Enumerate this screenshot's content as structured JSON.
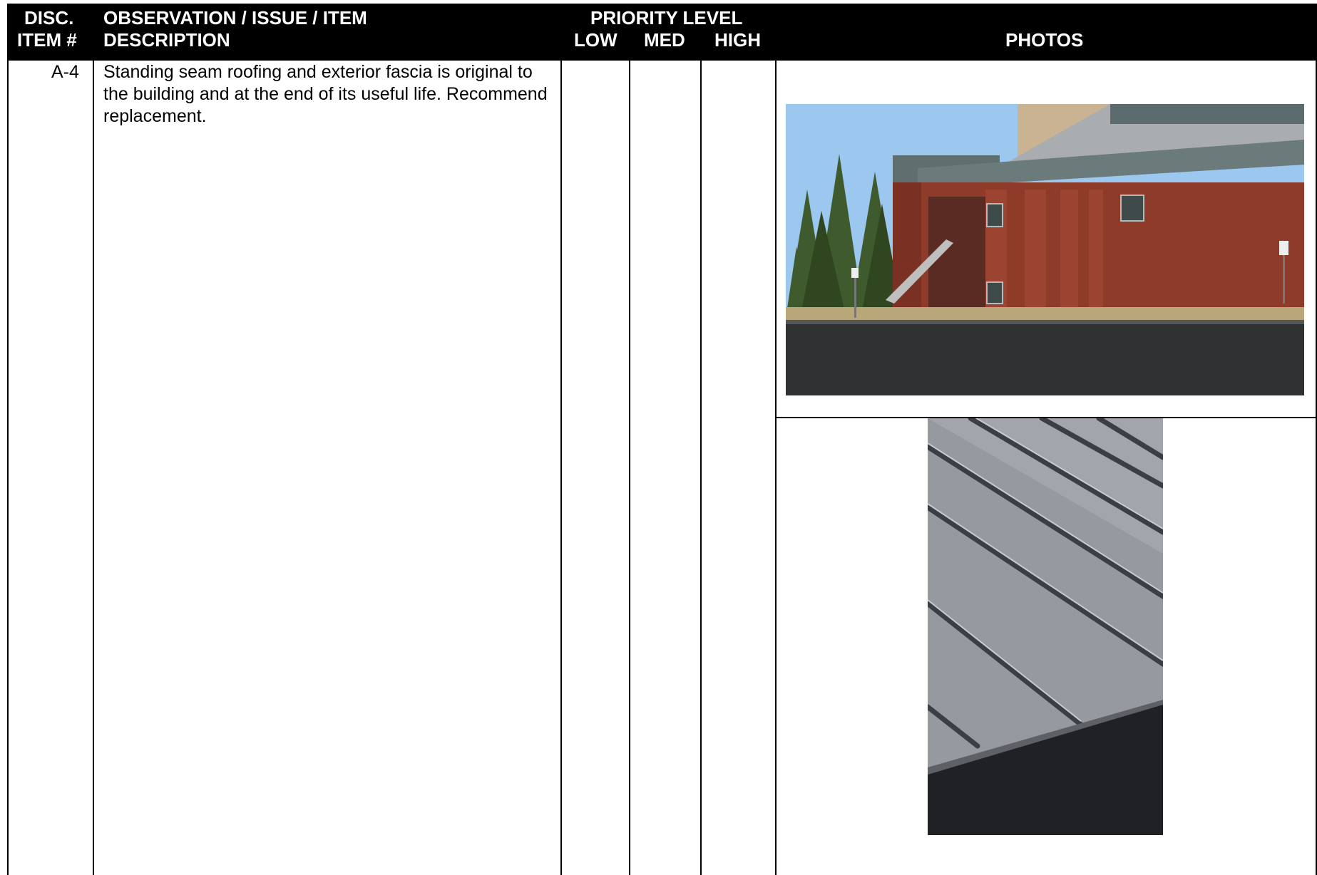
{
  "header": {
    "disc_line1": "DISC.",
    "disc_line2": "ITEM #",
    "obs_line1": "OBSERVATION / ISSUE / ITEM",
    "obs_line2": "DESCRIPTION",
    "priority": "PRIORITY LEVEL",
    "low": "LOW",
    "med": "MED",
    "high": "HIGH",
    "photos": "PHOTOS"
  },
  "rows": [
    {
      "item": "A-4",
      "description": "Standing seam roofing and exterior fascia is original to the building and at the end of its useful life. Recommend replacement.",
      "priority": {
        "low": "",
        "med": "",
        "high": ""
      }
    }
  ],
  "colors": {
    "header_bg": "#000000",
    "header_text": "#ffffff",
    "brick": "#8e3b2a",
    "sky": "#9cc7ee",
    "roof_gray": "#8d9094"
  }
}
